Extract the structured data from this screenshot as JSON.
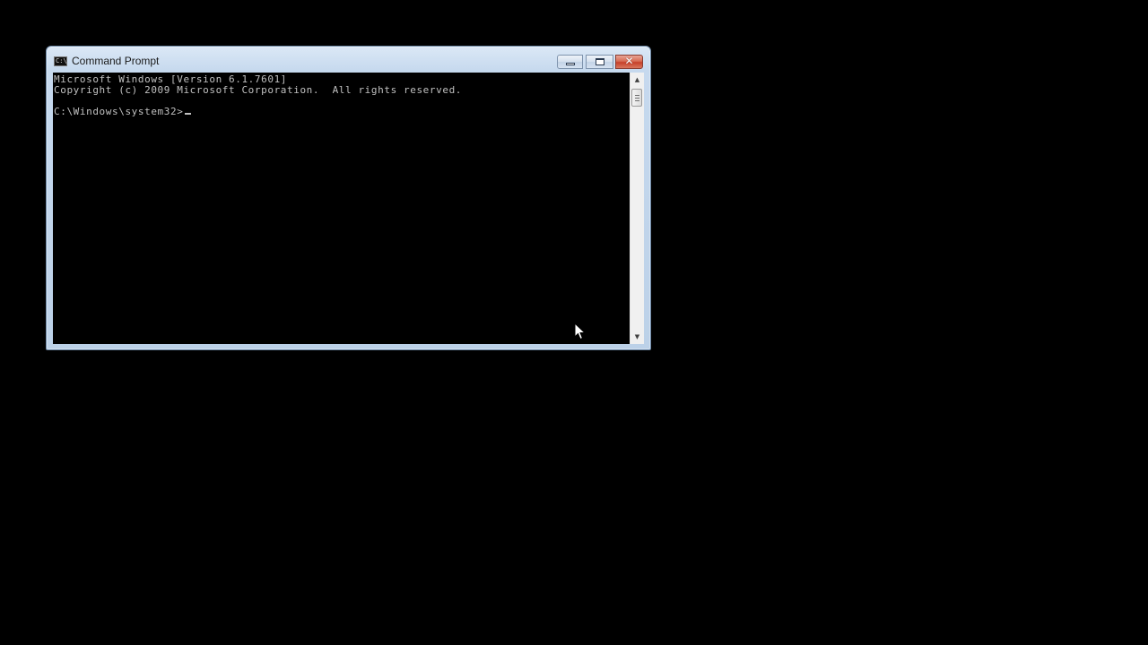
{
  "window": {
    "title": "Command Prompt",
    "app_icon_text": "C:\\",
    "controls": {
      "minimize_icon": "minimize-icon",
      "maximize_icon": "maximize-icon",
      "close_icon": "close-icon",
      "close_glyph": "✕"
    }
  },
  "console": {
    "lines": [
      "Microsoft Windows [Version 6.1.7601]",
      "Copyright (c) 2009 Microsoft Corporation.  All rights reserved.",
      "C:\\Windows\\system32>"
    ],
    "text_color": "#c0c0c0",
    "background": "#000000"
  },
  "scrollbar": {
    "up_arrow": "▲",
    "down_arrow": "▼"
  },
  "colors": {
    "desktop": "#000000",
    "window_frame": "#bcd1e8",
    "close_button": "#c6402a"
  }
}
